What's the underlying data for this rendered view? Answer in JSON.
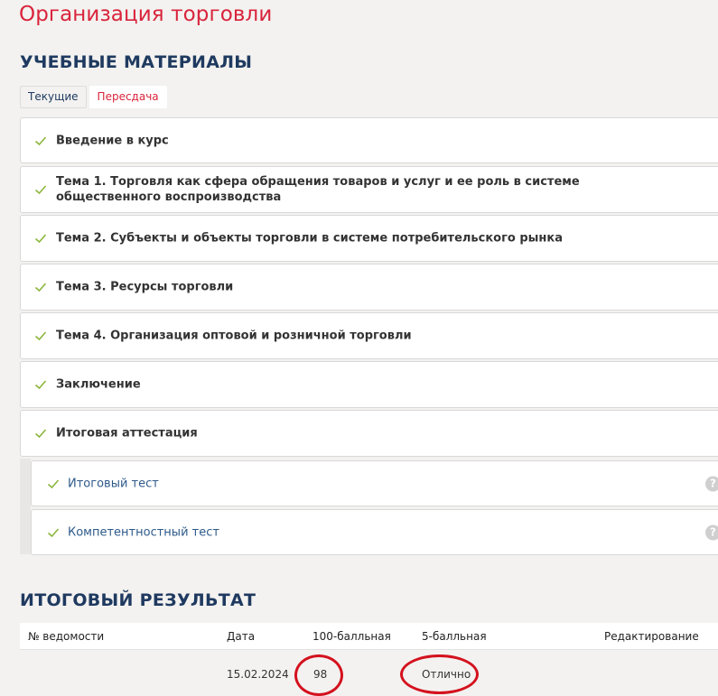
{
  "page": {
    "title": "Организация торговли"
  },
  "materials": {
    "heading": "УЧЕБНЫЕ МАТЕРИАЛЫ",
    "tabs": [
      {
        "label": "Текущие",
        "active": false
      },
      {
        "label": "Пересдача",
        "active": true
      }
    ],
    "modules": [
      {
        "label": "Введение в курс",
        "completed": true
      },
      {
        "label": "Тема 1. Торговля как сфера обращения товаров и услуг и ее роль в системе общественного воспроизводства",
        "completed": true
      },
      {
        "label": "Тема 2. Субъекты и объекты торговли в системе потребительского рынка",
        "completed": true
      },
      {
        "label": "Тема 3. Ресурсы торговли",
        "completed": true
      },
      {
        "label": "Тема 4. Организация оптовой и розничной торговли",
        "completed": true
      },
      {
        "label": "Заключение",
        "completed": true
      },
      {
        "label": "Итоговая аттестация",
        "completed": true
      }
    ],
    "submodules": [
      {
        "label": "Итоговый тест",
        "completed": true,
        "help_icon": "question-icon"
      },
      {
        "label": "Компетентностный тест",
        "completed": true,
        "help_icon": "question-icon"
      }
    ]
  },
  "results": {
    "heading": "ИТОГОВЫЙ РЕЗУЛЬТАТ",
    "columns": [
      "№ ведомости",
      "Дата",
      "100-балльная",
      "5-балльная",
      "Редактирование"
    ],
    "rows": [
      {
        "statement_no": "",
        "date": "15.02.2024",
        "score_100": "98",
        "score_5": "Отлично",
        "edit": ""
      }
    ]
  },
  "colors": {
    "accent_red": "#d9243c",
    "heading_navy": "#1f3a60",
    "check_green": "#8cb63c",
    "link_blue": "#2e5a8a",
    "highlight_circle": "#d4111e"
  }
}
